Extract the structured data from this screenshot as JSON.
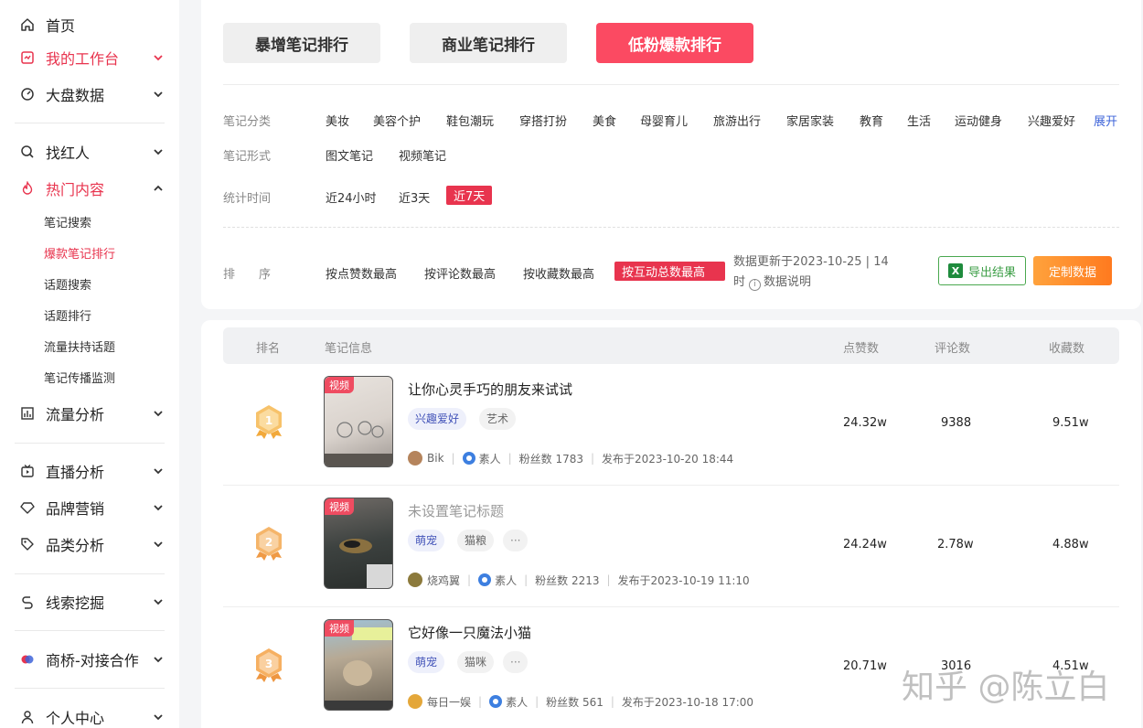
{
  "sidebar": {
    "items": [
      {
        "label": "首页",
        "icon": "home-icon"
      },
      {
        "label": "我的工作台",
        "icon": "workbench-icon"
      },
      {
        "label": "大盘数据",
        "icon": "dashboard-icon"
      },
      {
        "label": "找红人",
        "icon": "search-icon"
      },
      {
        "label": "热门内容",
        "icon": "fire-icon"
      },
      {
        "label": "流量分析",
        "icon": "bar-chart-icon"
      },
      {
        "label": "直播分析",
        "icon": "live-tv-icon"
      },
      {
        "label": "品牌营销",
        "icon": "diamond-icon"
      },
      {
        "label": "品类分析",
        "icon": "tag-icon"
      },
      {
        "label": "线索挖掘",
        "icon": "link-icon"
      },
      {
        "label": "商桥-对接合作",
        "icon": "bridge-logo-icon"
      },
      {
        "label": "个人中心",
        "icon": "user-icon"
      }
    ],
    "sub_items": [
      "笔记搜索",
      "爆款笔记排行",
      "话题搜索",
      "话题排行",
      "流量扶持话题",
      "笔记传播监测"
    ]
  },
  "tabs": [
    "暴增笔记排行",
    "商业笔记排行",
    "低粉爆款排行"
  ],
  "filters": {
    "category_label": "笔记分类",
    "categories": [
      "美妆",
      "美容个护",
      "鞋包潮玩",
      "穿搭打扮",
      "美食",
      "母婴育儿",
      "旅游出行",
      "家居家装",
      "教育",
      "生活",
      "运动健身",
      "兴趣爱好"
    ],
    "expand_label": "展开",
    "format_label": "笔记形式",
    "formats": [
      "图文笔记",
      "视频笔记"
    ],
    "time_label": "统计时间",
    "times": [
      "近24小时",
      "近3天",
      "近7天"
    ],
    "sort_label": "排　　序",
    "sorts": [
      "按点赞数最高",
      "按评论数最高",
      "按收藏数最高",
      "按互动总数最高"
    ],
    "update_text": "数据更新于2023-10-25 | 14时",
    "data_info": "数据说明",
    "export_label": "导出结果",
    "custom_label": "定制数据"
  },
  "table": {
    "headers": [
      "排名",
      "笔记信息",
      "点赞数",
      "评论数",
      "收藏数"
    ],
    "rows": [
      {
        "rank": "1",
        "badge": "视频",
        "title": "让你心灵手巧的朋友来试试",
        "tags": [
          "兴趣爱好",
          "艺术"
        ],
        "author": "Bik",
        "role": "素人",
        "fans": "粉丝数 1783",
        "published": "发布于2023-10-20 18:44",
        "likes": "24.32w",
        "comments": "9388",
        "collects": "9.51w"
      },
      {
        "rank": "2",
        "badge": "视频",
        "title": "未设置笔记标题",
        "tags": [
          "萌宠",
          "猫粮",
          "···"
        ],
        "author": "烧鸡翼",
        "role": "素人",
        "fans": "粉丝数 2213",
        "published": "发布于2023-10-19 11:10",
        "likes": "24.24w",
        "comments": "2.78w",
        "collects": "4.88w"
      },
      {
        "rank": "3",
        "badge": "视频",
        "title": "它好像一只魔法小猫",
        "tags": [
          "萌宠",
          "猫咪",
          "···"
        ],
        "author": "每日一娱",
        "role": "素人",
        "fans": "粉丝数 561",
        "published": "发布于2023-10-18 17:00",
        "likes": "20.71w",
        "comments": "3016",
        "collects": "4.51w"
      }
    ]
  },
  "watermark": "知乎 @陈立白",
  "colors": {
    "accent": "#e8344e",
    "tab_active": "#fb4a62",
    "link_blue": "#3e64d9",
    "excel_green": "#1f8b3d",
    "custom_orange": "#ff7a1f"
  }
}
